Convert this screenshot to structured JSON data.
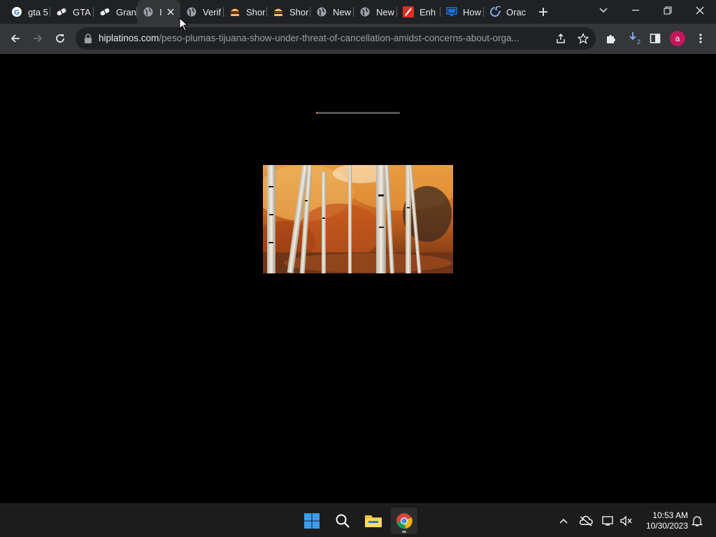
{
  "browser": {
    "tabs": [
      {
        "title": "gta 5",
        "icon": "google-icon"
      },
      {
        "title": "GTA",
        "icon": "pill-icon"
      },
      {
        "title": "Gran",
        "icon": "pill-icon"
      },
      {
        "title": "I",
        "icon": "globe-icon",
        "active": true
      },
      {
        "title": "Verif",
        "icon": "globe-icon"
      },
      {
        "title": "Shor",
        "icon": "burger-icon"
      },
      {
        "title": "Shor",
        "icon": "burger-icon"
      },
      {
        "title": "New",
        "icon": "globe-icon"
      },
      {
        "title": "New",
        "icon": "globe-icon"
      },
      {
        "title": "Enh",
        "icon": "pen-icon"
      },
      {
        "title": "How",
        "icon": "monitor-icon"
      },
      {
        "title": "Orac",
        "icon": "swirl-icon"
      }
    ],
    "url_domain": "hiplatinos.com",
    "url_path": "/peso-plumas-tijuana-show-under-threat-of-cancellation-amidst-concerns-about-orga...",
    "profile_initial": "a",
    "download_count": "2",
    "colors": {
      "profile": "#c2185b",
      "loader": "#e07a2e",
      "accent": "#8ab4f8"
    }
  },
  "page": {
    "loading_progress": 0.02
  },
  "taskbar": {
    "time": "10:53 AM",
    "date": "10/30/2023",
    "apps": [
      "windows-start-icon",
      "search-icon",
      "file-explorer-icon",
      "chrome-icon"
    ]
  }
}
